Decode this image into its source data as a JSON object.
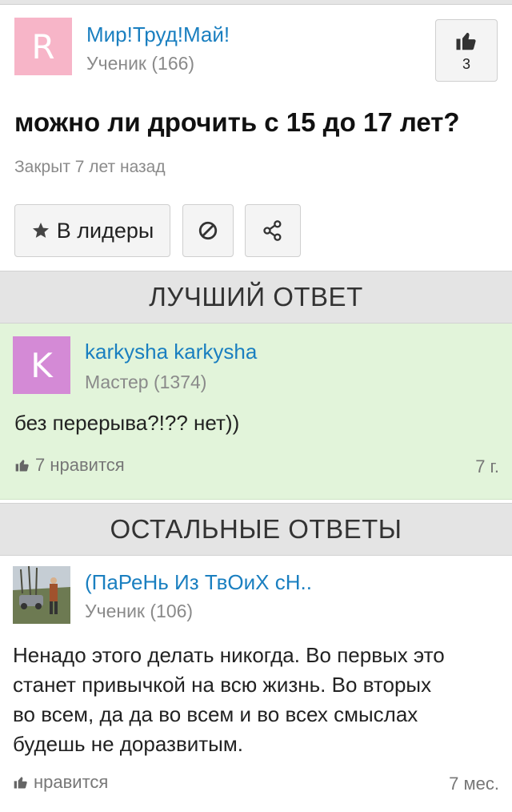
{
  "question_card": {
    "avatar_letter": "R",
    "avatar_color": "#f7b5c8",
    "user_name": "Мир!Труд!Май!",
    "user_rank": "Ученик (166)",
    "like_count": "3",
    "question_text": "можно ли дрочить с 15 до 17 лет?",
    "status": "Закрыт 7 лет назад",
    "leaders_button_label": "В лидеры",
    "report_icon": "ban-icon",
    "share_icon": "share-icon"
  },
  "best_answer": {
    "section_title": "ЛУЧШИЙ ОТВЕТ",
    "avatar_letter": "K",
    "avatar_color": "#d48ad6",
    "user_name": "karkysha karkysha",
    "user_rank": "Мастер (1374)",
    "text": "без перерыва?!?? нет))",
    "likes": "7 нравится",
    "age": "7 г.",
    "background_color": "#e2f4da"
  },
  "other_answers": {
    "section_title": "ОСТАЛЬНЫЕ ОТВЕТЫ",
    "items": [
      {
        "user_name": "(ПаРеНь Из ТвОиХ сН..",
        "user_rank": "Ученик (106)",
        "text_lines": [
          "Ненадо этого делать никогда. Во первых это",
          "станет привычкой на всю жизнь. Во вторых",
          "во всем, да да во всем и во всех смыслах",
          "будешь не доразвитым."
        ],
        "likes": "нравится",
        "age": "7 мес."
      }
    ]
  },
  "colors": {
    "link_blue": "#1a7fc0",
    "muted_gray": "#8a8a8a",
    "section_gray": "#e4e4e4"
  }
}
